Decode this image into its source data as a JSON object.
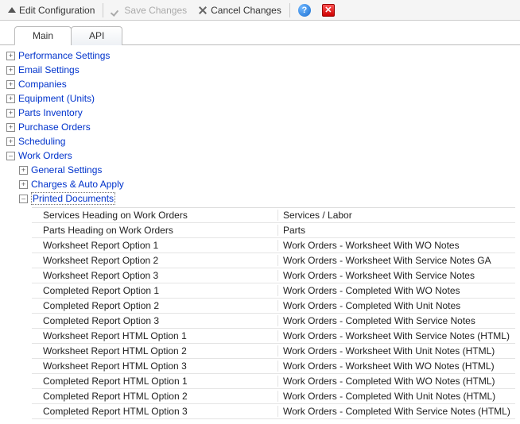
{
  "toolbar": {
    "edit_label": "Edit Configuration",
    "save_label": "Save Changes",
    "cancel_label": "Cancel Changes"
  },
  "tabs": {
    "main": "Main",
    "api": "API"
  },
  "tree": {
    "performance": "Performance Settings",
    "email": "Email Settings",
    "companies": "Companies",
    "equipment": "Equipment (Units)",
    "parts": "Parts Inventory",
    "purchase": "Purchase Orders",
    "scheduling": "Scheduling",
    "work_orders": "Work Orders",
    "general_settings": "General Settings",
    "charges": "Charges & Auto Apply",
    "printed_docs": "Printed Documents"
  },
  "grid": [
    {
      "label": "Services Heading on Work Orders",
      "value": "Services / Labor"
    },
    {
      "label": "Parts Heading on Work Orders",
      "value": "Parts"
    },
    {
      "label": "Worksheet Report Option 1",
      "value": "Work Orders - Worksheet With WO Notes"
    },
    {
      "label": "Worksheet Report Option 2",
      "value": "Work Orders - Worksheet With Service Notes  GA"
    },
    {
      "label": "Worksheet Report Option 3",
      "value": "Work Orders - Worksheet With Service Notes"
    },
    {
      "label": "Completed Report Option 1",
      "value": "Work Orders - Completed With WO Notes"
    },
    {
      "label": "Completed Report Option 2",
      "value": "Work Orders - Completed With Unit Notes"
    },
    {
      "label": "Completed Report Option 3",
      "value": "Work Orders - Completed With Service Notes"
    },
    {
      "label": "Worksheet Report HTML Option 1",
      "value": "Work Orders - Worksheet With Service Notes (HTML)"
    },
    {
      "label": "Worksheet Report HTML Option 2",
      "value": "Work Orders - Worksheet With Unit Notes (HTML)"
    },
    {
      "label": "Worksheet Report HTML Option 3",
      "value": "Work Orders - Worksheet With WO Notes (HTML)"
    },
    {
      "label": "Completed Report HTML Option 1",
      "value": "Work Orders - Completed With WO Notes (HTML)"
    },
    {
      "label": "Completed Report HTML Option 2",
      "value": "Work Orders - Completed With Unit Notes (HTML)"
    },
    {
      "label": "Completed Report HTML Option 3",
      "value": "Work Orders - Completed With Service Notes (HTML)"
    }
  ]
}
